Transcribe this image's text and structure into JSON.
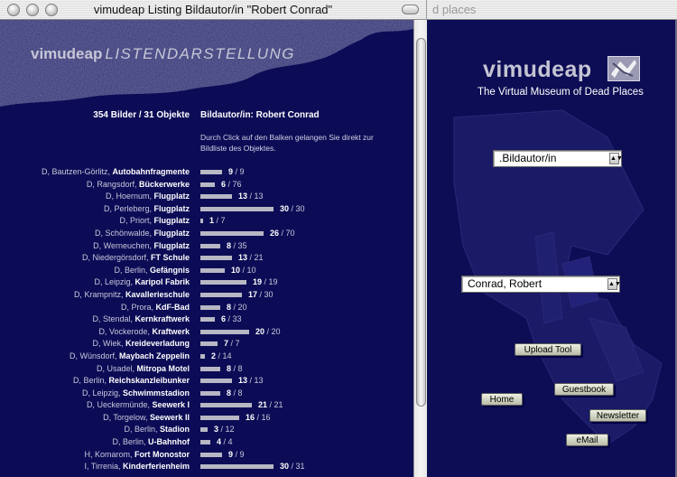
{
  "front_window": {
    "title": "vimudeap Listing Bildautor/in \"Robert Conrad\"",
    "logo": {
      "brand": "vimudeap",
      "section": "LISTENDARSTELLUNG"
    },
    "summary": "354 Bilder / 31 Objekte",
    "heading": "Bildautor/in: Robert Conrad",
    "hint": "Durch Click auf den Balken gelangen Sie direkt zur Bildliste des Objektes.",
    "rows": [
      {
        "place": "D, Bautzen-Görlitz, ",
        "object": "Autobahnfragmente",
        "shown": 9,
        "total": 9
      },
      {
        "place": "D, Rangsdorf, ",
        "object": "Bückerwerke",
        "shown": 6,
        "total": 76
      },
      {
        "place": "D, Hoernum, ",
        "object": "Flugplatz",
        "shown": 13,
        "total": 13
      },
      {
        "place": "D, Perleberg, ",
        "object": "Flugplatz",
        "shown": 30,
        "total": 30
      },
      {
        "place": "D, Priort, ",
        "object": "Flugplatz",
        "shown": 1,
        "total": 7
      },
      {
        "place": "D, Schönwalde, ",
        "object": "Flugplatz",
        "shown": 26,
        "total": 70
      },
      {
        "place": "D, Werneuchen, ",
        "object": "Flugplatz",
        "shown": 8,
        "total": 35
      },
      {
        "place": "D, Niedergörsdorf, ",
        "object": "FT Schule",
        "shown": 13,
        "total": 21
      },
      {
        "place": "D, Berlin, ",
        "object": "Gefängnis",
        "shown": 10,
        "total": 10
      },
      {
        "place": "D, Leipzig, ",
        "object": "Karipol Fabrik",
        "shown": 19,
        "total": 19
      },
      {
        "place": "D, Krampnitz, ",
        "object": "Kavallerieschule",
        "shown": 17,
        "total": 30
      },
      {
        "place": "D, Prora, ",
        "object": "KdF-Bad",
        "shown": 8,
        "total": 20
      },
      {
        "place": "D, Stendal, ",
        "object": "Kernkraftwerk",
        "shown": 6,
        "total": 33
      },
      {
        "place": "D, Vockerode, ",
        "object": "Kraftwerk",
        "shown": 20,
        "total": 20
      },
      {
        "place": "D, Wiek, ",
        "object": "Kreideverladung",
        "shown": 7,
        "total": 7
      },
      {
        "place": "D, Wünsdorf, ",
        "object": "Maybach Zeppelin",
        "shown": 2,
        "total": 14
      },
      {
        "place": "D, Usadel, ",
        "object": "Mitropa Motel",
        "shown": 8,
        "total": 8
      },
      {
        "place": "D, Berlin, ",
        "object": "Reichskanzleibunker",
        "shown": 13,
        "total": 13
      },
      {
        "place": "D, Leipzig, ",
        "object": "Schwimmstadion",
        "shown": 8,
        "total": 8
      },
      {
        "place": "D, Ueckermünde, ",
        "object": "Seewerk I",
        "shown": 21,
        "total": 21
      },
      {
        "place": "D, Torgelow, ",
        "object": "Seewerk II",
        "shown": 16,
        "total": 16
      },
      {
        "place": "D, Berlin, ",
        "object": "Stadion",
        "shown": 3,
        "total": 12
      },
      {
        "place": "D, Berlin, ",
        "object": "U-Bahnhof",
        "shown": 4,
        "total": 4
      },
      {
        "place": "H, Komarom, ",
        "object": "Fort Monostor",
        "shown": 9,
        "total": 9
      },
      {
        "place": "I, Tirrenia, ",
        "object": "Kinderferienheim",
        "shown": 30,
        "total": 31
      }
    ]
  },
  "back_window": {
    "title_fragment": "d places",
    "brand": "vimudeap",
    "tagline": "The Virtual Museum of Dead Places",
    "category_select": ".Bildautor/in",
    "author_select": "Conrad, Robert",
    "buttons": {
      "upload": "Upload Tool",
      "guestbook": "Guestbook",
      "home": "Home",
      "newsletter": "Newsletter",
      "email": "eMail"
    }
  },
  "colors": {
    "page_bg": "#0c0c56",
    "bar": "#b8b8c4",
    "text": "#c8c8dc",
    "button": "#d8dcc8"
  }
}
